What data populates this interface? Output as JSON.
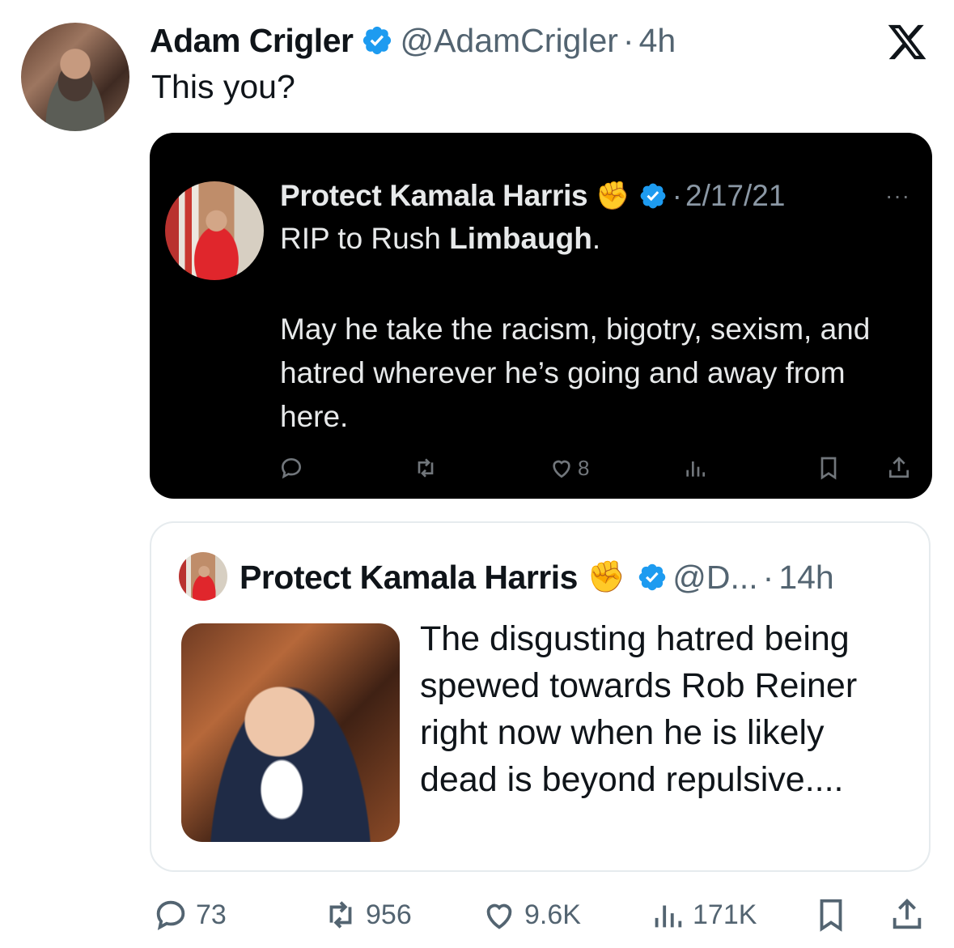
{
  "post": {
    "author_name": "Adam Crigler",
    "handle": "@AdamCrigler",
    "separator": "·",
    "time": "4h",
    "text": "This you?",
    "icons": {
      "verified": "verified-badge-icon",
      "logo": "x-logo-icon"
    }
  },
  "embedded_screenshot": {
    "author_name": "Protect Kamala Harris",
    "emoji": "✊",
    "separator": "·",
    "date": "2/17/21",
    "more": "···",
    "line1_prefix": "RIP to Rush ",
    "line1_bold": "Limbaugh",
    "line1_suffix": ".",
    "body": "May he take the racism, bigotry, sexism, and hatred wherever he’s going and away from here.",
    "likes": "8"
  },
  "quoted": {
    "author_name": "Protect Kamala Harris",
    "emoji": "✊",
    "handle": "@D...",
    "separator": "·",
    "time": "14h",
    "text": "The disgusting hatred being spewed towards Rob Reiner right now when he is likely dead is beyond repulsive...."
  },
  "actions": {
    "replies": "73",
    "reposts": "956",
    "likes": "9.6K",
    "views": "171K"
  },
  "colors": {
    "text": "#0f1419",
    "muted": "#536471",
    "verified": "#1d9bf0",
    "dark_card_bg": "#000000"
  }
}
